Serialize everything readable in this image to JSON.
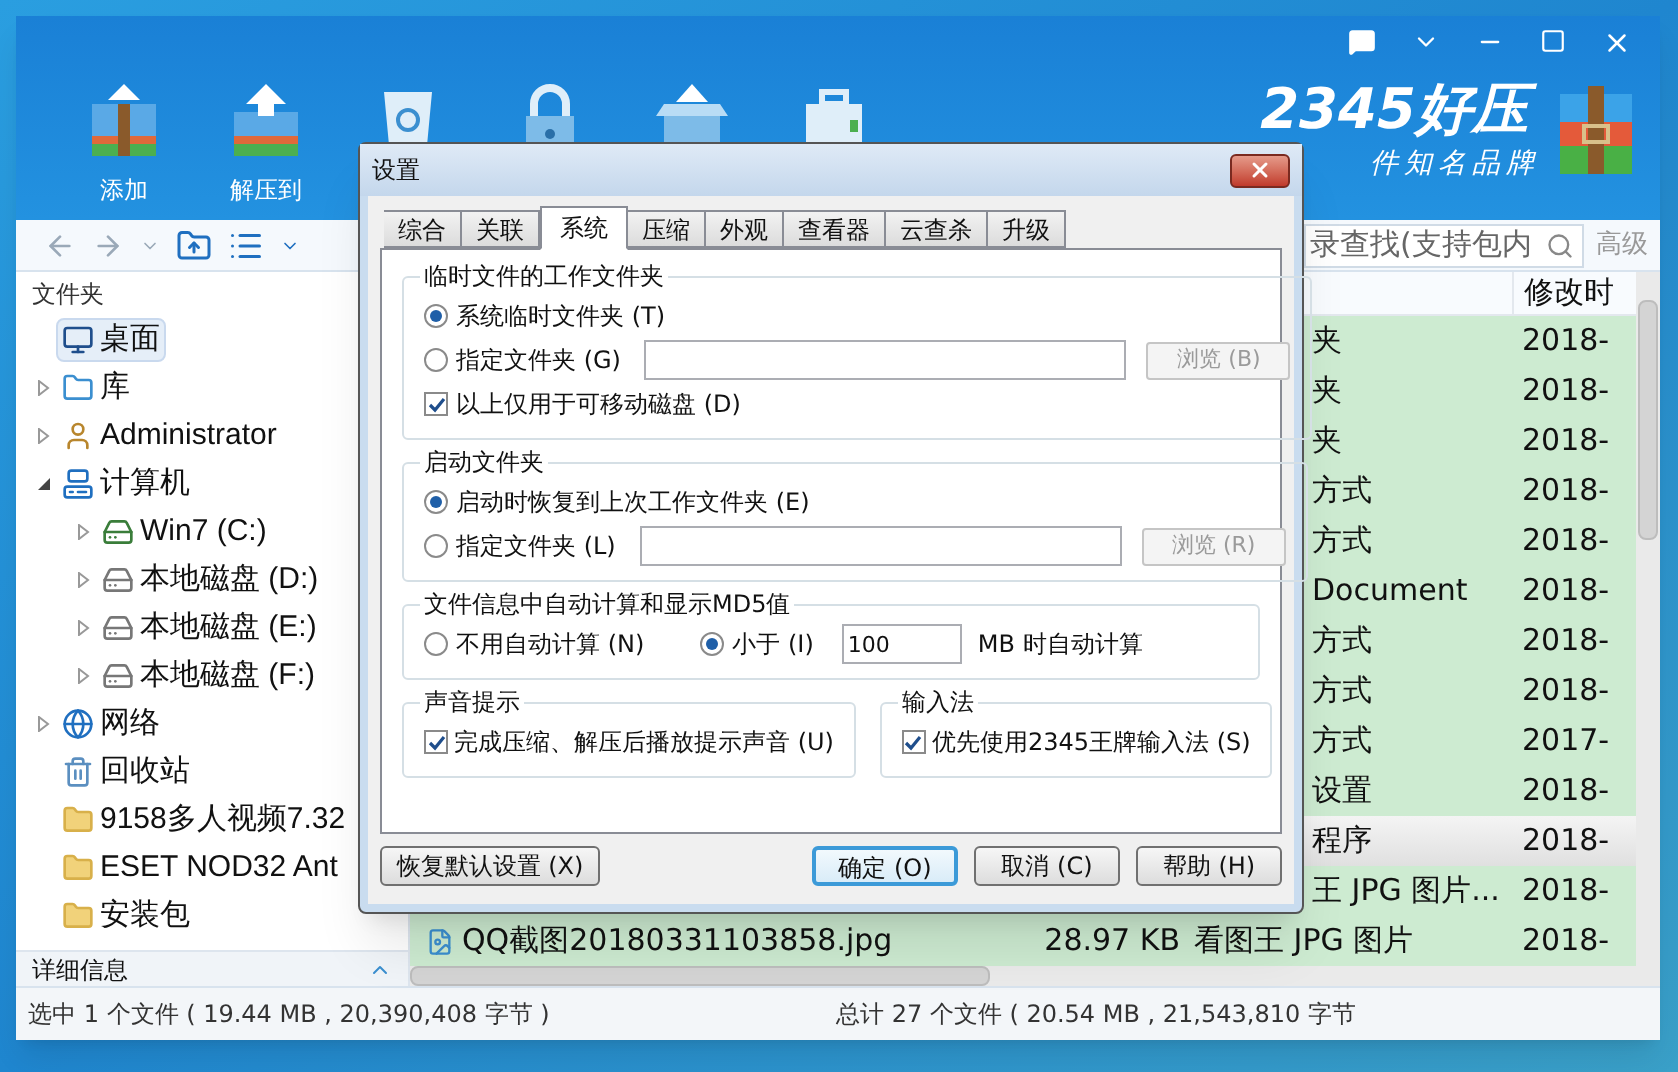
{
  "toolbar": [
    {
      "label": "添加",
      "kind": "add"
    },
    {
      "label": "解压到",
      "kind": "extract"
    },
    {
      "kind": "recycle"
    },
    {
      "kind": "lock"
    },
    {
      "kind": "box"
    },
    {
      "kind": "case"
    }
  ],
  "brand": {
    "name": "2345好压",
    "slogan": "件知名品牌"
  },
  "search": {
    "placeholder": "录查找(支持包内",
    "advanced": "高级"
  },
  "tree": {
    "header": "文件夹",
    "items": [
      {
        "label": "桌面",
        "kind": "desktop",
        "selected": true
      },
      {
        "label": "库",
        "kind": "library",
        "selected": false,
        "expanded": false
      },
      {
        "label": "Administrator",
        "kind": "user",
        "selected": false,
        "expanded": false
      },
      {
        "label": "计算机",
        "kind": "computer",
        "selected": false,
        "expanded": true,
        "children": [
          {
            "label": "Win7 (C:)",
            "kind": "system-drive",
            "selected": false,
            "expanded": false
          },
          {
            "label": "本地磁盘 (D:)",
            "kind": "drive",
            "selected": false,
            "expanded": false
          },
          {
            "label": "本地磁盘 (E:)",
            "kind": "drive",
            "selected": false,
            "expanded": false
          },
          {
            "label": "本地磁盘 (F:)",
            "kind": "drive",
            "selected": false,
            "expanded": false
          }
        ]
      },
      {
        "label": "网络",
        "kind": "network",
        "selected": false,
        "expanded": false
      },
      {
        "label": "回收站",
        "kind": "recycle",
        "selected": false
      },
      {
        "label": "9158多人视频7.32",
        "kind": "folder",
        "selected": false
      },
      {
        "label": "ESET NOD32 Ant",
        "kind": "folder",
        "selected": false
      },
      {
        "label": "安装包",
        "kind": "folder",
        "selected": false
      }
    ]
  },
  "details_bar": {
    "label": "详细信息"
  },
  "file_list": {
    "header": "修改时",
    "rows": [
      {
        "type": "夹",
        "modified": "2018-",
        "selected": false
      },
      {
        "type": "夹",
        "modified": "2018-",
        "selected": false
      },
      {
        "type": "夹",
        "modified": "2018-",
        "selected": false
      },
      {
        "type": "方式",
        "modified": "2018-",
        "selected": false
      },
      {
        "type": "方式",
        "modified": "2018-",
        "selected": false
      },
      {
        "type": "Document",
        "modified": "2018-",
        "selected": false
      },
      {
        "type": "方式",
        "modified": "2018-",
        "selected": false
      },
      {
        "type": "方式",
        "modified": "2018-",
        "selected": false
      },
      {
        "type": "方式",
        "modified": "2017-",
        "selected": false
      },
      {
        "type": "设置",
        "modified": "2018-",
        "selected": false
      },
      {
        "type": "程序",
        "modified": "2018-",
        "selected": true
      },
      {
        "type": "王 JPG 图片...",
        "modified": "2018-",
        "selected": false
      },
      {
        "name": "QQ截图20180331103858.jpg",
        "size": "28.97 KB",
        "type": "看图王 JPG 图片",
        "modified": "2018-",
        "selected": false
      }
    ]
  },
  "status_bar": {
    "left": "选中 1 个文件 ( 19.44 MB , 20,390,408 字节 )",
    "right": "总计 27 个文件 ( 20.54 MB , 21,543,810 字节"
  },
  "dialog": {
    "title": "设置",
    "tabs": [
      {
        "label": "综合",
        "selected": false
      },
      {
        "label": "关联",
        "selected": false
      },
      {
        "label": "系统",
        "selected": true
      },
      {
        "label": "压缩",
        "selected": false
      },
      {
        "label": "外观",
        "selected": false
      },
      {
        "label": "查看器",
        "selected": false
      },
      {
        "label": "云查杀",
        "selected": false
      },
      {
        "label": "升级",
        "selected": false
      }
    ],
    "temp_folder": {
      "title": "临时文件的工作文件夹",
      "options": [
        {
          "label": "系统临时文件夹 (T)",
          "selected": true
        },
        {
          "label": "指定文件夹 (G)",
          "selected": false,
          "browse": {
            "label": "浏览 (B)",
            "disabled": true
          }
        }
      ],
      "removable_only": {
        "label": "以上仅用于可移动磁盘 (D)",
        "checked": true
      }
    },
    "startup_folder": {
      "title": "启动文件夹",
      "options": [
        {
          "label": "启动时恢复到上次工作文件夹 (E)",
          "selected": true
        },
        {
          "label": "指定文件夹 (L)",
          "selected": false,
          "browse": {
            "label": "浏览 (R)",
            "disabled": true
          }
        }
      ]
    },
    "md5": {
      "title": "文件信息中自动计算和显示MD5值",
      "options": [
        {
          "label": "不用自动计算 (N)",
          "selected": false
        },
        {
          "label": "小于 (I)",
          "selected": true
        }
      ],
      "value": "100",
      "unit": "MB 时自动计算"
    },
    "sound": {
      "title": "声音提示",
      "label": "完成压缩、解压后播放提示声音 (U)",
      "checked": true
    },
    "ime": {
      "title": "输入法",
      "label": "优先使用2345王牌输入法 (S)",
      "checked": true
    },
    "buttons": [
      {
        "label": "恢复默认设置 (X)",
        "kind": "reset"
      },
      {
        "label": "确定 (O)",
        "kind": "default"
      },
      {
        "label": "取消 (C)",
        "kind": "normal"
      },
      {
        "label": "帮助 (H)",
        "kind": "normal"
      }
    ]
  }
}
